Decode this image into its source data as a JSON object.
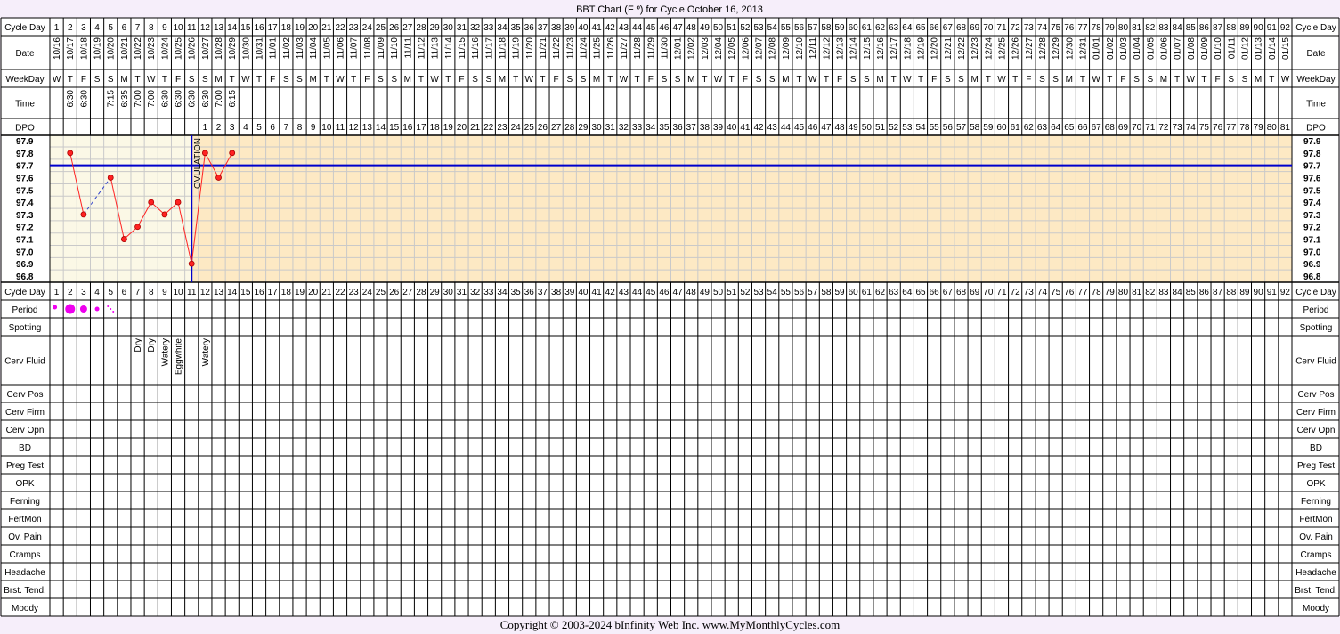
{
  "header": {
    "title": "BBT Chart (F º) for Cycle October 16, 2013"
  },
  "labels": {
    "cycle_day": "Cycle Day",
    "date": "Date",
    "weekday": "WeekDay",
    "time": "Time",
    "dpo": "DPO",
    "period": "Period",
    "spotting": "Spotting",
    "cerv_fluid": "Cerv Fluid",
    "cerv_pos": "Cerv Pos",
    "cerv_firm": "Cerv Firm",
    "cerv_opn": "Cerv Opn",
    "bd": "BD",
    "preg_test": "Preg Test",
    "opk": "OPK",
    "ferning": "Ferning",
    "fertmon": "FertMon",
    "ov_pain": "Ov. Pain",
    "cramps": "Cramps",
    "headache": "Headache",
    "brst_tend": "Brst. Tend.",
    "moody": "Moody"
  },
  "chart_data": {
    "type": "line",
    "x": [
      1,
      2,
      3,
      4,
      5,
      6,
      7,
      8,
      9,
      10,
      11,
      12,
      13,
      14
    ],
    "series": [
      {
        "values": [
          null,
          97.8,
          97.3,
          null,
          97.6,
          97.1,
          97.2,
          97.4,
          97.3,
          97.4,
          96.9,
          97.8,
          97.6,
          97.8
        ]
      }
    ],
    "ylim": [
      96.8,
      97.9
    ],
    "y_ticks": [
      "97.9",
      "97.8",
      "97.7",
      "97.6",
      "97.5",
      "97.4",
      "97.3",
      "97.2",
      "97.1",
      "97.0",
      "96.9",
      "96.8"
    ],
    "cycle_days": 92,
    "coverline": 97.7,
    "ovulation_day": 11,
    "ovulation_label": "OVULATION",
    "dates": [
      "10/16",
      "10/17",
      "10/18",
      "10/19",
      "10/20",
      "10/21",
      "10/22",
      "10/23",
      "10/24",
      "10/25",
      "10/26",
      "10/27",
      "10/28",
      "10/29",
      "10/30",
      "10/31",
      "11/01",
      "11/02",
      "11/03",
      "11/04",
      "11/05",
      "11/06",
      "11/07",
      "11/08",
      "11/09",
      "11/10",
      "11/11",
      "11/12",
      "11/13",
      "11/14",
      "11/15",
      "11/16",
      "11/17",
      "11/18",
      "11/19",
      "11/20",
      "11/21",
      "11/22",
      "11/23",
      "11/24",
      "11/25",
      "11/26",
      "11/27",
      "11/28",
      "11/29",
      "11/30",
      "12/01",
      "12/02",
      "12/03",
      "12/04",
      "12/05",
      "12/06",
      "12/07",
      "12/08",
      "12/09",
      "12/10",
      "12/11",
      "12/12",
      "12/13",
      "12/14",
      "12/15",
      "12/16",
      "12/17",
      "12/18",
      "12/19",
      "12/20",
      "12/21",
      "12/22",
      "12/23",
      "12/24",
      "12/25",
      "12/26",
      "12/27",
      "12/28",
      "12/29",
      "12/30",
      "12/31",
      "01/01",
      "01/02",
      "01/03",
      "01/04",
      "01/05",
      "01/06",
      "01/07",
      "01/08",
      "01/09",
      "01/10",
      "01/11",
      "01/12",
      "01/13",
      "01/14",
      "01/15"
    ],
    "weekdays": [
      "W",
      "T",
      "F",
      "S",
      "S",
      "M",
      "T",
      "W",
      "T",
      "F",
      "S",
      "S",
      "M",
      "T",
      "W",
      "T",
      "F",
      "S",
      "S",
      "M",
      "T",
      "W",
      "T",
      "F",
      "S",
      "S",
      "M",
      "T",
      "W",
      "T",
      "F",
      "S",
      "S",
      "M",
      "T",
      "W",
      "T",
      "F",
      "S",
      "S",
      "M",
      "T",
      "W",
      "T",
      "F",
      "S",
      "S",
      "M",
      "T",
      "W",
      "T",
      "F",
      "S",
      "S",
      "M",
      "T",
      "W",
      "T",
      "F",
      "S",
      "S",
      "M",
      "T",
      "W",
      "T",
      "F",
      "S",
      "S",
      "M",
      "T",
      "W",
      "T",
      "F",
      "S",
      "S",
      "M",
      "T",
      "W",
      "T",
      "F",
      "S",
      "S",
      "M",
      "T",
      "W",
      "T",
      "F",
      "S",
      "S",
      "M",
      "T",
      "W"
    ],
    "times": [
      "",
      "6:30",
      "6:30",
      "",
      "7:15",
      "6:35",
      "7:00",
      "7:00",
      "6:30",
      "6:30",
      "6:30",
      "6:30",
      "7:00",
      "6:15"
    ],
    "dpo_start_day": 12,
    "dpo_count": 81,
    "period": [
      1,
      3,
      2,
      1,
      0.5
    ],
    "cerv_fluid": {
      "7": "Dry",
      "8": "Dry",
      "9": "Watery",
      "10": "Eggwhite",
      "12": "Watery"
    }
  },
  "footer": {
    "copyright": "Copyright © 2003-2024 bInfinity Web Inc.     www.MyMonthlyCycles.com"
  }
}
